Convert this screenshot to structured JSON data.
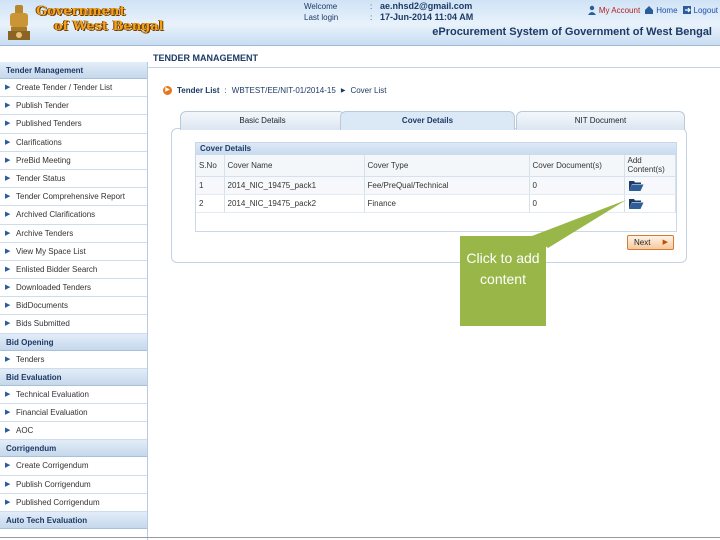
{
  "header": {
    "brand_line1": "Government",
    "brand_line2": "of West Bengal",
    "welcome_label": "Welcome",
    "welcome_sep": ":",
    "welcome_value": "ae.nhsd2@gmail.com",
    "lastlogin_label": "Last login",
    "lastlogin_sep": ":",
    "lastlogin_value": "17-Jun-2014 11:04 AM",
    "my_account": "My Account",
    "home": "Home",
    "logout": "Logout",
    "system_name": "eProcurement System of Government of West Bengal"
  },
  "page_title": "TENDER MANAGEMENT",
  "breadcrumb": {
    "root": "Tender List",
    "sep": ":",
    "ref": "WBTEST/EE/NIT-01/2014-15",
    "current": "Cover List"
  },
  "tabs": [
    "Basic Details",
    "Cover Details",
    "NIT Document"
  ],
  "cover_table": {
    "caption": "Cover Details",
    "headers": [
      "S.No",
      "Cover Name",
      "Cover Type",
      "Cover Document(s)",
      "Add Content(s)"
    ],
    "rows": [
      {
        "sno": "1",
        "name": "2014_NIC_19475_pack1",
        "type": "Fee/PreQual/Technical",
        "docs": "0"
      },
      {
        "sno": "2",
        "name": "2014_NIC_19475_pack2",
        "type": "Finance",
        "docs": "0"
      }
    ]
  },
  "next_button": "Next",
  "callout": "Click to add content",
  "sidebar": {
    "sections": [
      {
        "title": "Tender Management",
        "items": [
          "Create Tender / Tender List",
          "Publish Tender",
          "Published Tenders",
          "Clarifications",
          "PreBid Meeting",
          "Tender Status",
          "Tender Comprehensive Report",
          "Archived Clarifications",
          "Archive Tenders",
          "View My Space List",
          "Enlisted Bidder Search",
          "Downloaded Tenders",
          "BidDocuments",
          "Bids Submitted"
        ]
      },
      {
        "title": "Bid Opening",
        "items": [
          "Tenders"
        ]
      },
      {
        "title": "Bid Evaluation",
        "items": [
          "Technical Evaluation",
          "Financial Evaluation",
          "AOC"
        ]
      },
      {
        "title": "Corrigendum",
        "items": [
          "Create Corrigendum",
          "Publish Corrigendum",
          "Published Corrigendum"
        ]
      },
      {
        "title": "Auto Tech Evaluation",
        "items": []
      }
    ]
  },
  "colors": {
    "accent": "#1d3a66",
    "callout": "#99b649",
    "brand": "#f4a21d"
  },
  "icons": [
    "emblem",
    "user-icon",
    "home-icon",
    "logout-icon",
    "folder-icon"
  ]
}
